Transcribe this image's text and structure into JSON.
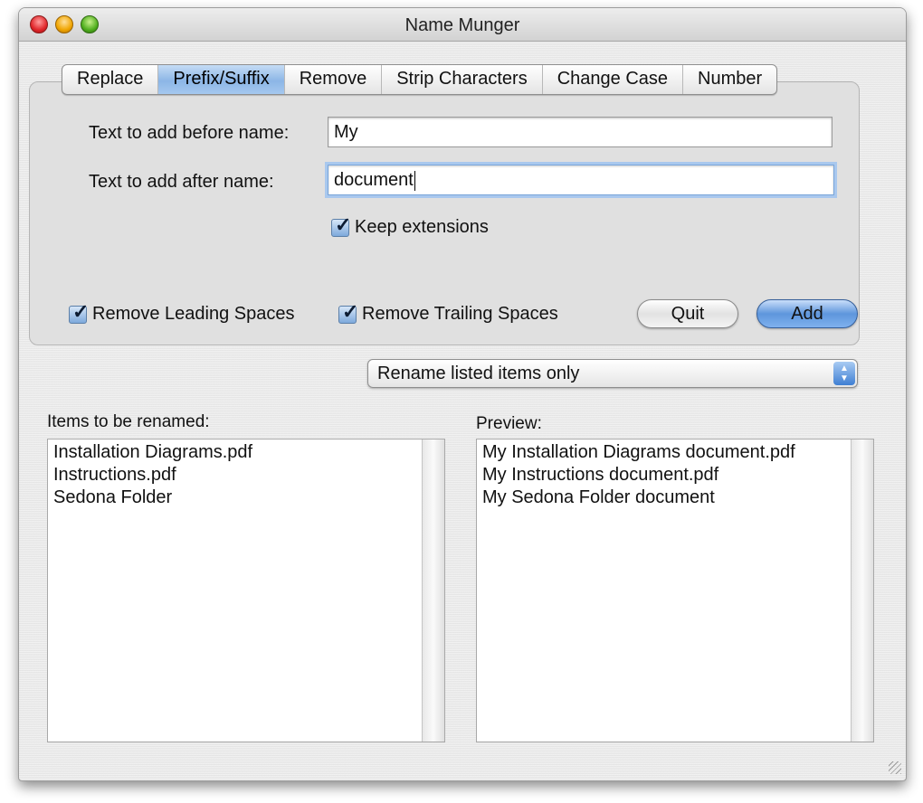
{
  "window": {
    "title": "Name Munger"
  },
  "tabs": [
    {
      "label": "Replace"
    },
    {
      "label": "Prefix/Suffix",
      "selected": true
    },
    {
      "label": "Remove"
    },
    {
      "label": "Strip Characters"
    },
    {
      "label": "Change Case"
    },
    {
      "label": "Number"
    }
  ],
  "form": {
    "before_label": "Text to add before name:",
    "before_value": "My",
    "after_label": "Text to add after name:",
    "after_value": "document",
    "keep_extensions_label": "Keep extensions",
    "keep_extensions_checked": true,
    "remove_leading_label": "Remove Leading Spaces",
    "remove_leading_checked": true,
    "remove_trailing_label": "Remove Trailing Spaces",
    "remove_trailing_checked": true,
    "quit_label": "Quit",
    "add_label": "Add"
  },
  "scope": {
    "selected": "Rename listed items only"
  },
  "lists": {
    "items_label": "Items to be renamed:",
    "items": [
      "Installation Diagrams.pdf",
      "Instructions.pdf",
      "Sedona Folder"
    ],
    "preview_label": "Preview:",
    "preview": [
      "My Installation Diagrams document.pdf",
      "My Instructions document.pdf",
      "My Sedona Folder document"
    ]
  },
  "colors": {
    "selected_tab": "#8cb6e6",
    "default_button": "#5e96dc",
    "focus_ring": "#a9c8ee"
  }
}
